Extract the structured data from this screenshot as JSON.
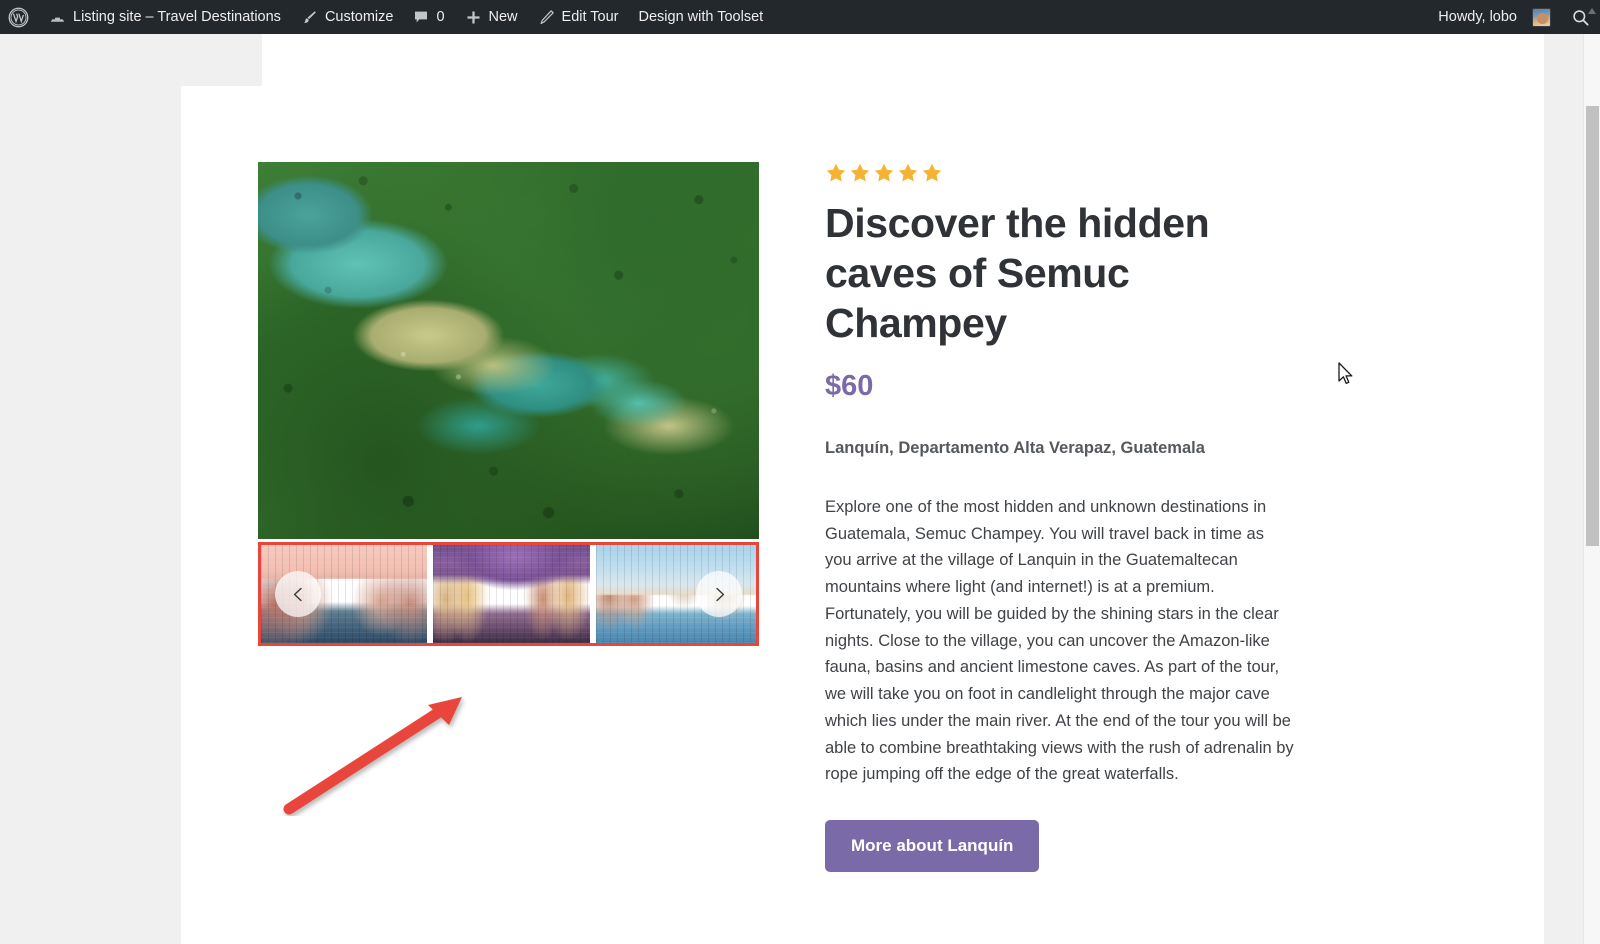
{
  "adminbar": {
    "wp_logo_icon": "wordpress-logo-icon",
    "site_icon": "dashboard-speedometer-icon",
    "site_name": "Listing site – Travel Destinations",
    "customize_icon": "paintbrush-icon",
    "customize_label": "Customize",
    "comments_icon": "comment-bubble-icon",
    "comments_count": "0",
    "new_icon": "plus-icon",
    "new_label": "New",
    "edit_icon": "pencil-icon",
    "edit_label": "Edit Tour",
    "toolset_label": "Design with Toolset",
    "howdy": "Howdy, lobo",
    "avatar_icon": "user-avatar",
    "search_icon": "search-icon"
  },
  "gallery": {
    "hero_alt": "Aerial view of turquoise limestone pools of Semuc Champey surrounded by jungle",
    "prev_icon": "chevron-left-icon",
    "next_icon": "chevron-right-icon",
    "thumbnails": [
      {
        "alt": "Venice Grand Canal at pink sunset"
      },
      {
        "alt": "Venice side canal at purple dusk with lit windows"
      },
      {
        "alt": "Venice basilica dome on the lagoon under blue sky"
      }
    ],
    "highlight_color": "#e8453c"
  },
  "listing": {
    "rating_stars": 5,
    "star_icon": "star-filled-icon",
    "star_color": "#f5b335",
    "title": "Discover the hidden caves of Semuc Champey",
    "price": "$60",
    "price_color": "#7b6aa8",
    "location": "Lanquín, Departamento Alta Verapaz, Guatemala",
    "description": "Explore one of the most hidden and unknown destinations in Guatemala, Semuc Champey. You will travel back in time as you arrive at the village of Lanquin in the Guatemaltecan mountains where light (and internet!) is at a premium. Fortunately, you will be guided by the shining stars in the clear nights. Close to the village, you can uncover the Amazon-like fauna, basins and ancient limestone caves. As part of the tour, we will take you on foot in candlelight through the major cave which lies under the main river. At the end of the tour you will be able to combine breathtaking views with the rush of adrenalin by rope jumping off the edge of the great waterfalls.",
    "cta_label": "More about Lanquín",
    "cta_color": "#7b6aa8"
  },
  "annotation": {
    "arrow_icon": "red-pointer-arrow",
    "arrow_color": "#e8453c"
  },
  "scrollbar": {
    "up_arrow_icon": "scroll-up-arrow-icon",
    "thumb_icon": "scrollbar-thumb"
  },
  "cursor": {
    "icon": "mouse-pointer-icon"
  }
}
